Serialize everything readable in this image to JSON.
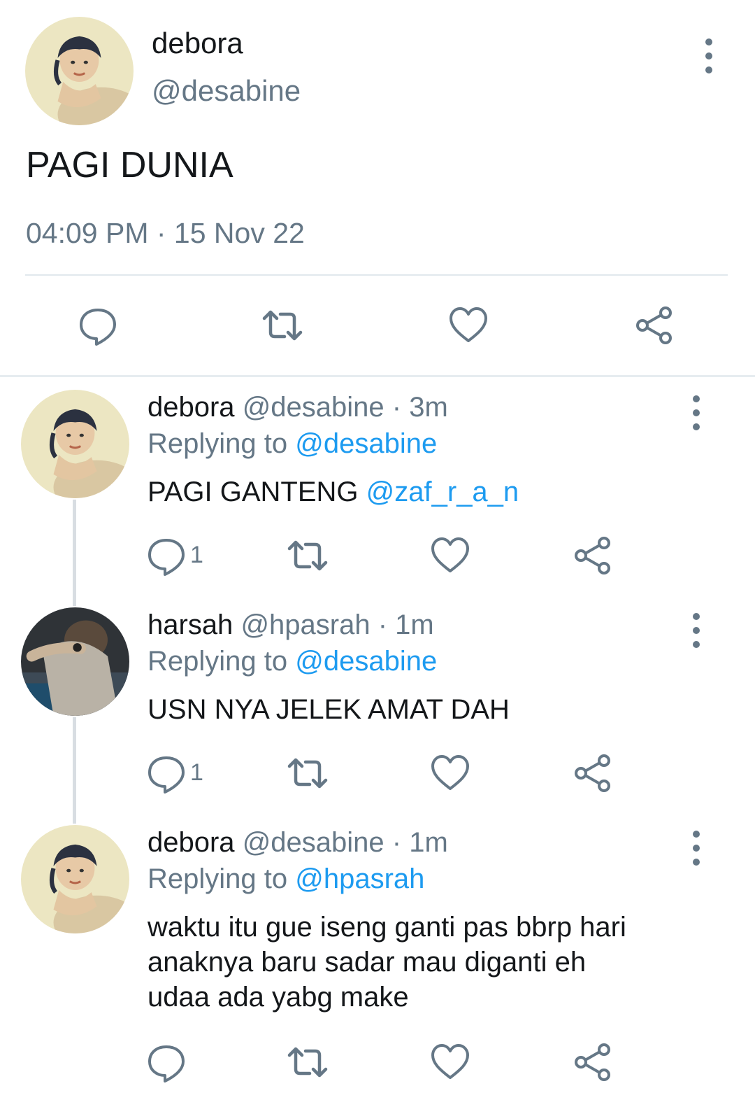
{
  "main_tweet": {
    "name": "debora",
    "handle": "@desabine",
    "text": "PAGI DUNIA",
    "timestamp": "04:09 PM · 15 Nov 22"
  },
  "replies": [
    {
      "name": "debora",
      "handle": "@desabine",
      "time": "· 3m",
      "replying_label": "Replying to",
      "replying_to": "@desabine",
      "text": "PAGI GANTENG",
      "mention": "@zaf_r_a_n",
      "reply_count": "1"
    },
    {
      "name": "harsah",
      "handle": "@hpasrah",
      "time": "· 1m",
      "replying_label": "Replying to",
      "replying_to": "@desabine",
      "text": "USN NYA JELEK AMAT DAH",
      "reply_count": "1"
    },
    {
      "name": "debora",
      "handle": "@desabine",
      "time": "· 1m",
      "replying_label": "Replying to",
      "replying_to": "@hpasrah",
      "text_lines": [
        "waktu itu gue iseng ganti pas bbrp hari",
        "anaknya baru sadar mau diganti eh",
        "udaa ada yabg make"
      ]
    }
  ],
  "icons": {
    "reply": "reply-icon",
    "retweet": "retweet-icon",
    "like": "heart-icon",
    "share": "share-icon",
    "more": "more-vertical-icon"
  },
  "colors": {
    "text": "#14171a",
    "secondary": "#657786",
    "link": "#1d9bf0",
    "divider": "#e1e8ed"
  }
}
